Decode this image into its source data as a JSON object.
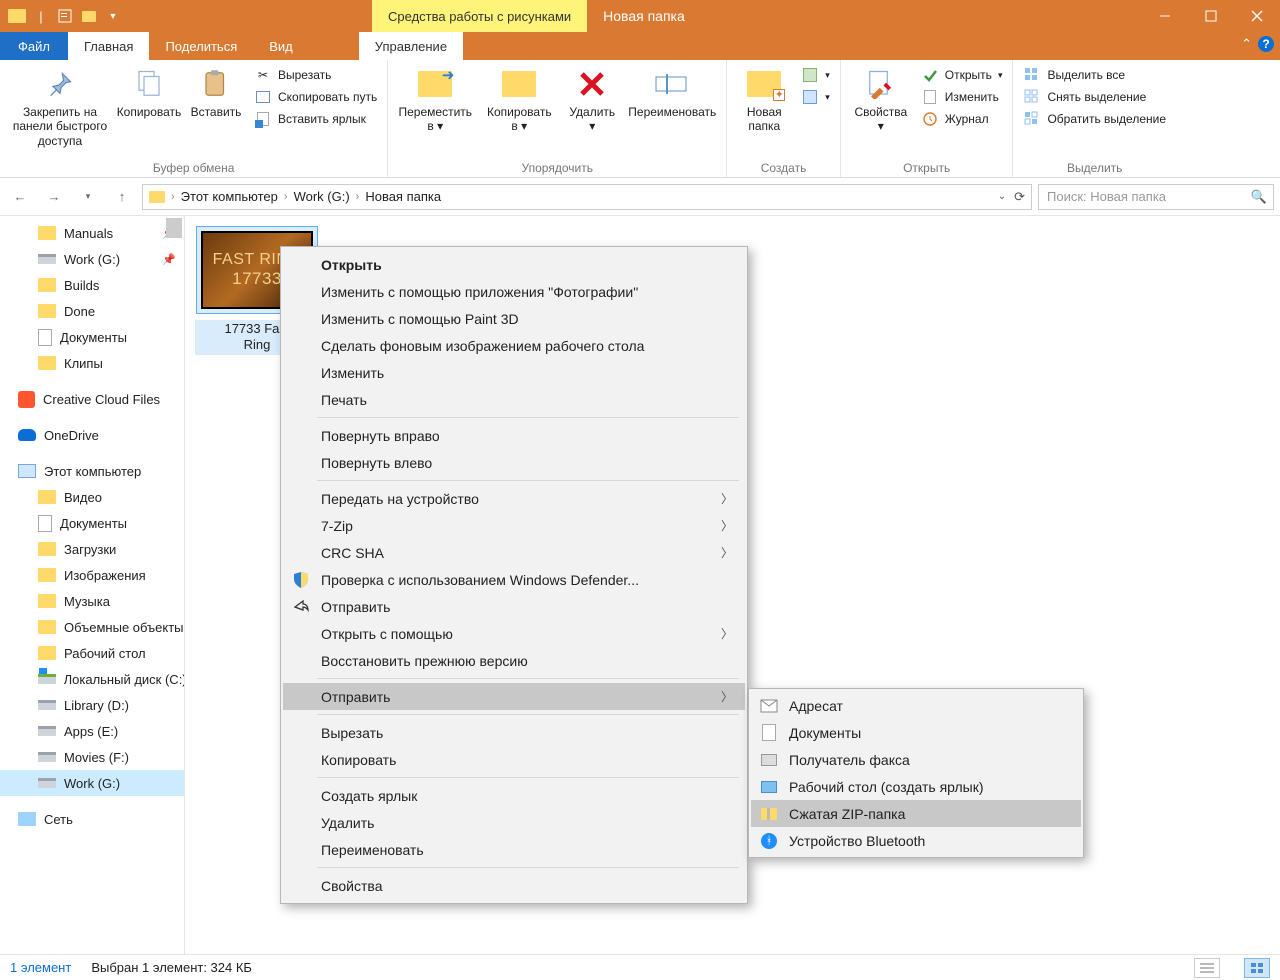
{
  "titlebar": {
    "context_tab": "Средства работы с рисунками",
    "title": "Новая папка"
  },
  "tabs": {
    "file": "Файл",
    "home": "Главная",
    "share": "Поделиться",
    "view": "Вид",
    "manage": "Управление"
  },
  "ribbon": {
    "groups": {
      "clipboard": "Буфер обмена",
      "organize": "Упорядочить",
      "create": "Создать",
      "open": "Открыть",
      "select": "Выделить"
    },
    "buttons": {
      "pin_quickaccess": "Закрепить на панели быстрого доступа",
      "copy": "Копировать",
      "paste": "Вставить",
      "cut": "Вырезать",
      "copy_path": "Скопировать путь",
      "paste_shortcut": "Вставить ярлык",
      "move_to": "Переместить в",
      "copy_to": "Копировать в",
      "delete": "Удалить",
      "rename": "Переименовать",
      "new_folder": "Новая папка",
      "properties": "Свойства",
      "open": "Открыть",
      "edit": "Изменить",
      "history": "Журнал",
      "select_all": "Выделить все",
      "select_none": "Снять выделение",
      "invert": "Обратить выделение"
    }
  },
  "breadcrumb": {
    "root": "Этот компьютер",
    "drive": "Work (G:)",
    "folder": "Новая папка"
  },
  "search": {
    "placeholder": "Поиск: Новая папка"
  },
  "tree": {
    "manuals": "Manuals",
    "workg": "Work (G:)",
    "builds": "Builds",
    "done": "Done",
    "documents": "Документы",
    "clips": "Клипы",
    "creativecloud": "Creative Cloud Files",
    "onedrive": "OneDrive",
    "thispc": "Этот компьютер",
    "video": "Видео",
    "documents2": "Документы",
    "downloads": "Загрузки",
    "images": "Изображения",
    "music": "Музыка",
    "objects3d": "Объемные объекты",
    "desktop": "Рабочий стол",
    "localdisk": "Локальный диск (C:)",
    "libraryd": "Library (D:)",
    "appse": "Apps (E:)",
    "moviesf": "Movies (F:)",
    "workg2": "Work (G:)",
    "network": "Сеть"
  },
  "file_item": {
    "thumb_line1": "FAST RING",
    "thumb_line2": "17733",
    "name_line1": "17733 Fast",
    "name_line2": "Ring"
  },
  "context_menu": {
    "open": "Открыть",
    "edit_photos": "Изменить с помощью приложения \"Фотографии\"",
    "paint3d": "Изменить с помощью Paint 3D",
    "set_wallpaper": "Сделать фоновым изображением рабочего стола",
    "edit": "Изменить",
    "print": "Печать",
    "rotate_right": "Повернуть вправо",
    "rotate_left": "Повернуть влево",
    "cast_device": "Передать на устройство",
    "sevenzip": "7-Zip",
    "crcsha": "CRC SHA",
    "defender": "Проверка с использованием Windows Defender...",
    "share": "Отправить",
    "open_with": "Открыть с помощью",
    "restore_prev": "Восстановить прежнюю версию",
    "send_to": "Отправить",
    "cut": "Вырезать",
    "copy": "Копировать",
    "create_shortcut": "Создать ярлык",
    "delete": "Удалить",
    "rename": "Переименовать",
    "properties": "Свойства"
  },
  "submenu": {
    "mail": "Адресат",
    "documents": "Документы",
    "fax": "Получатель факса",
    "desktop_shortcut": "Рабочий стол (создать ярлык)",
    "zip": "Сжатая ZIP-папка",
    "bluetooth": "Устройство Bluetooth"
  },
  "status": {
    "count": "1 элемент",
    "selection": "Выбран 1 элемент: 324 КБ"
  }
}
